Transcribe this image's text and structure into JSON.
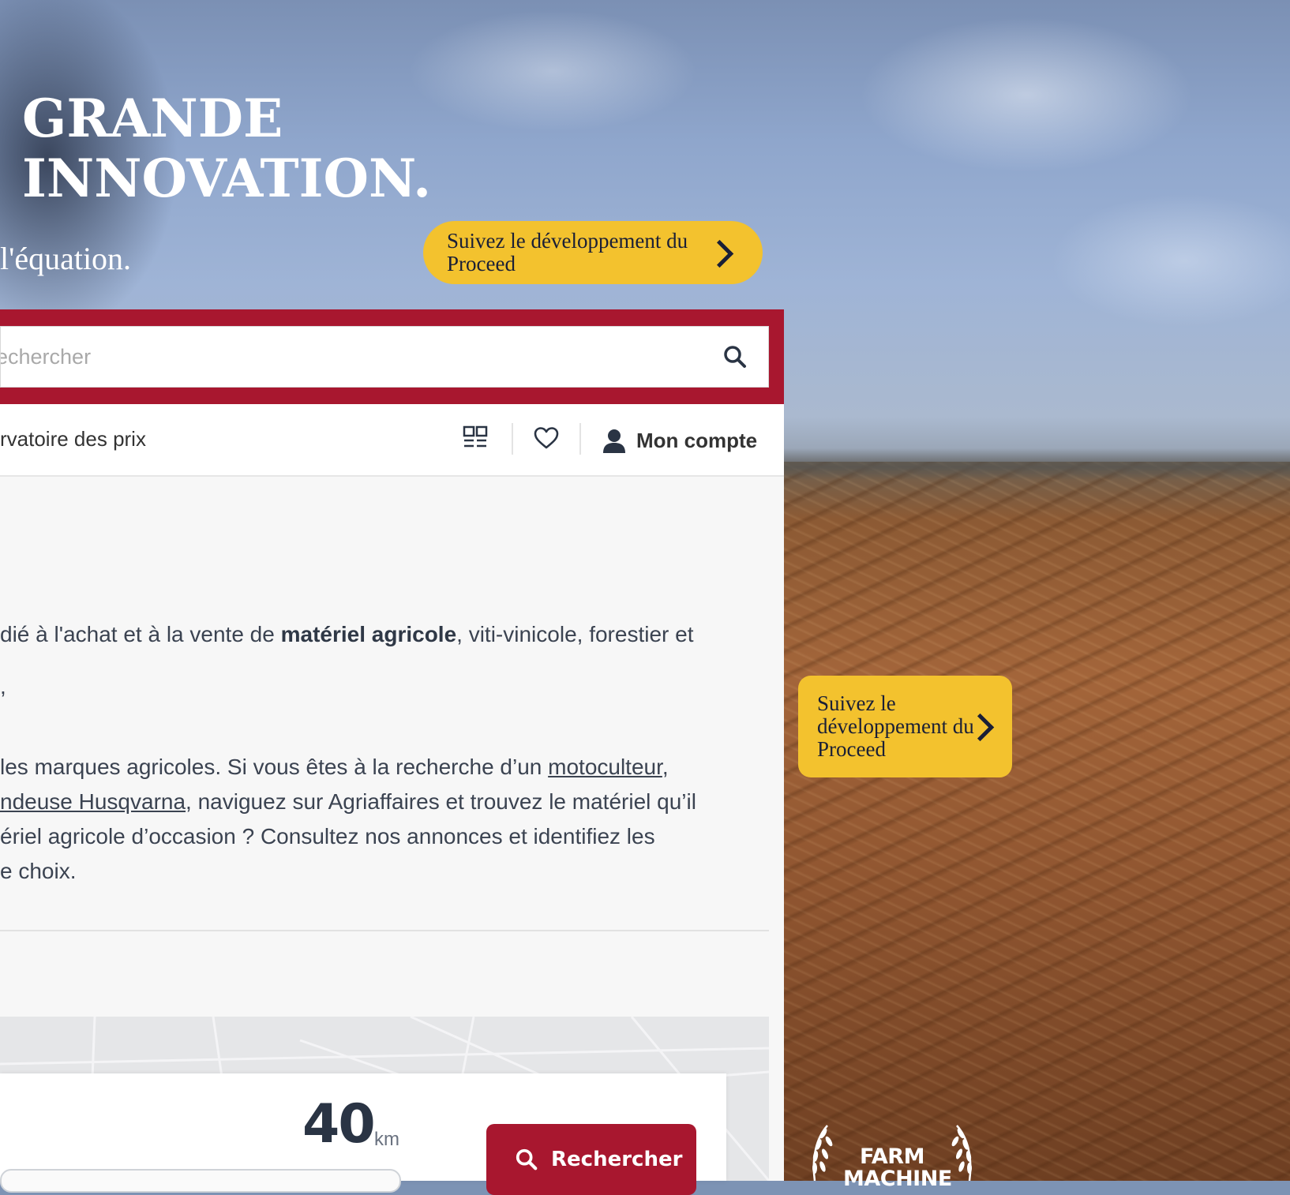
{
  "hero": {
    "title_line1": "GRANDE",
    "title_line2": "INNOVATION.",
    "subtitle": "l'équation.",
    "cta_top": "Suivez le développement du Proceed",
    "cta_side": "Suivez le développement du Proceed"
  },
  "search": {
    "placeholder": "echercher"
  },
  "nav": {
    "link": "rvatoire des prix",
    "account_label": "Mon compte",
    "icons": [
      "grid-icon",
      "heart-icon",
      "user-icon"
    ]
  },
  "content": {
    "p1_before": "dié à l'achat et à la vente de ",
    "p1_bold": "matériel agricole",
    "p1_after": ", viti-vinicole, forestier et",
    "p2": ",",
    "p3_before": "les marques agricoles. Si vous êtes à la recherche d’un ",
    "p3_link": "motoculteur",
    "p3_after": ",",
    "p4_link": "ndeuse Husqvarna",
    "p4_after": ", naviguez sur Agriaffaires et trouvez le matériel qu’il",
    "p5": "ériel agricole d’occasion ? Consultez nos annonces et identifiez les",
    "p6": "e choix."
  },
  "locator": {
    "radius_value": "40",
    "radius_unit": "km",
    "search_button": "Rechercher"
  },
  "award": {
    "text": "FARM MACHINE"
  },
  "colors": {
    "brand_red": "#a8172f",
    "cta_yellow": "#f3c22e",
    "text_dark": "#2a3444"
  }
}
